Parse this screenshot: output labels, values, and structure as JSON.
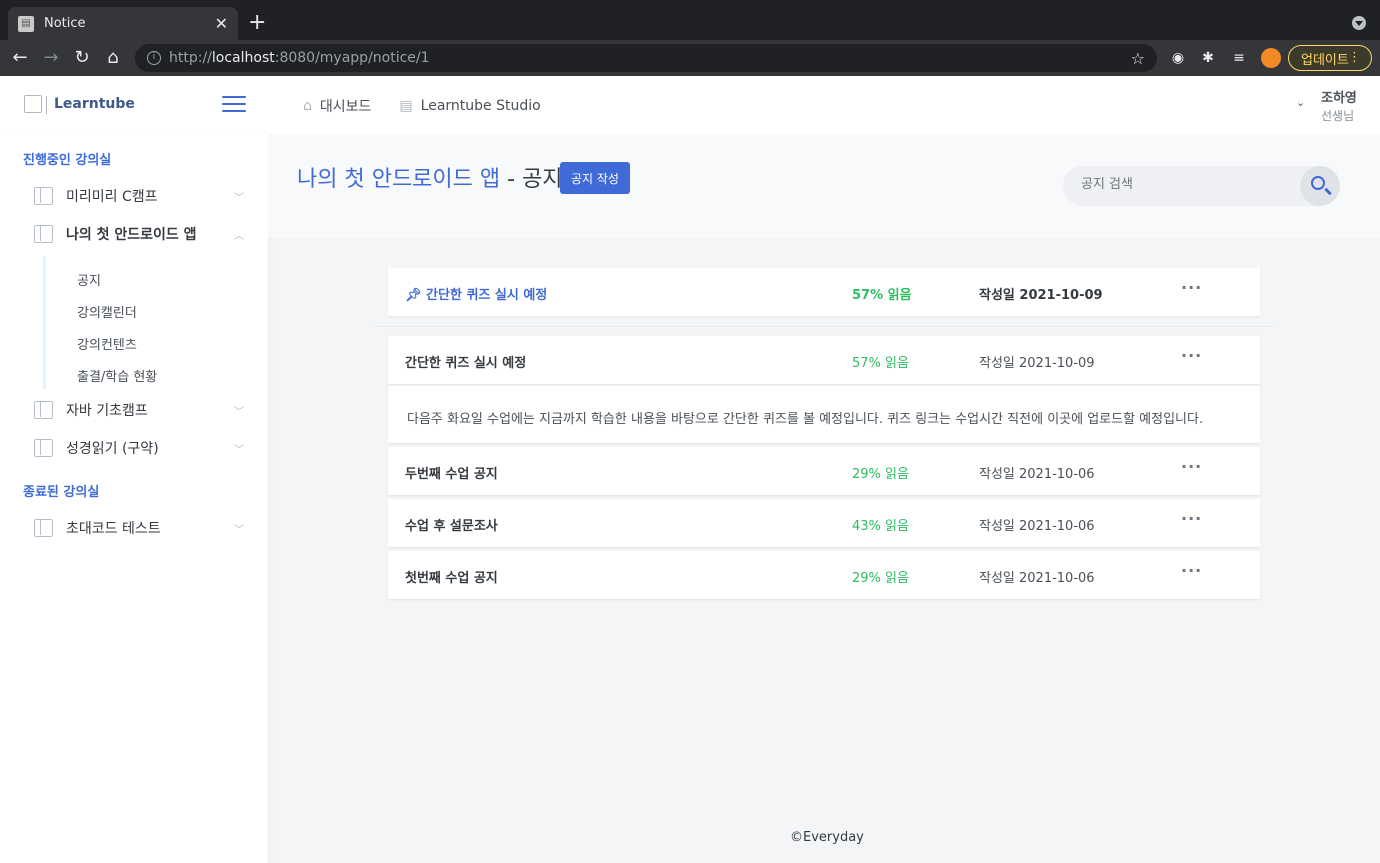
{
  "browser": {
    "tab_title": "Notice",
    "tab_close": "✕",
    "new_tab": "+",
    "url_scheme": "http://",
    "url_host": "localhost",
    "url_rest": ":8080/myapp/notice/1",
    "update_label": "업데이트"
  },
  "header": {
    "logo_text": "Learntube",
    "nav": [
      {
        "label": "대시보드",
        "icon": "home-icon"
      },
      {
        "label": "Learntube Studio",
        "icon": "film-icon"
      }
    ],
    "user_name": "조하영",
    "user_role": "선생님"
  },
  "sidebar": {
    "active_heading": "진행중인 강의실",
    "ended_heading": "종료된 강의실",
    "courses": [
      {
        "label": "미리미리 C캠프"
      },
      {
        "label": "나의 첫 안드로이드 앱"
      },
      {
        "label": "자바 기초캠프"
      },
      {
        "label": "성경읽기 (구약)"
      }
    ],
    "submenu": [
      "공지",
      "강의캘린더",
      "강의컨텐츠",
      "출결/학습 현황"
    ],
    "ended_courses": [
      {
        "label": "초대코드 테스트"
      }
    ]
  },
  "main": {
    "course_name": "나의 첫 안드로이드 앱",
    "title_suffix": " - 공지",
    "write_button": "공지 작성",
    "search_placeholder": "공지 검색",
    "pinned": {
      "title": "간단한 퀴즈 실시 예정",
      "pin_icon": "pin-icon",
      "progress": "57% 읽음",
      "date": "작성일 2021-10-09",
      "more": "···"
    },
    "notices": [
      {
        "title": "간단한 퀴즈 실시 예정",
        "progress": "57% 읽음",
        "date": "작성일 2021-10-09",
        "more": "···",
        "body": "다음주 화요일 수업에는 지금까지 학습한 내용을 바탕으로 간단한 퀴즈를 볼 예정입니다. 퀴즈 링크는 수업시간 직전에 이곳에 업로드할 예정입니다."
      },
      {
        "title": "두번째 수업 공지",
        "progress": "29% 읽음",
        "date": "작성일 2021-10-06",
        "more": "···"
      },
      {
        "title": "수업 후 설문조사",
        "progress": "43% 읽음",
        "date": "작성일 2021-10-06",
        "more": "···"
      },
      {
        "title": "첫번째 수업 공지",
        "progress": "29% 읽음",
        "date": "작성일 2021-10-06",
        "more": "···"
      }
    ]
  },
  "footer": {
    "text": "©Everyday"
  },
  "colors": {
    "accent": "#3f6ad8",
    "progress": "#2dbe60"
  }
}
